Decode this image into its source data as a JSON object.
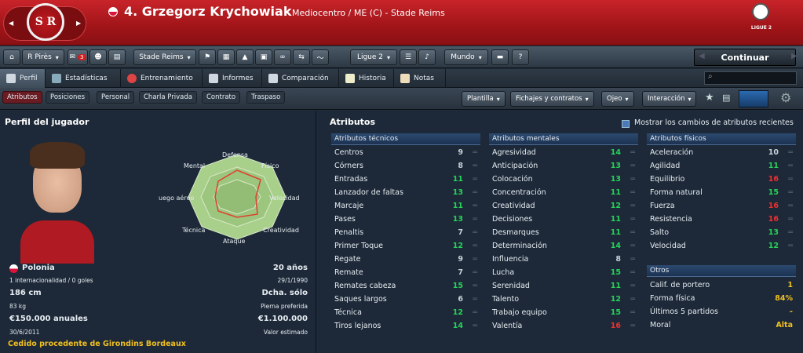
{
  "header": {
    "player_title": "4. Grzegorz Krychowiak",
    "role": "Mediocentro / ME (C) - Stade Reims",
    "crest_text": "S R",
    "league_text": "LIGUE 2"
  },
  "toolbar": {
    "manager": "R Pirès",
    "notifications": "3",
    "club": "Stade Reims",
    "league": "Ligue 2",
    "world": "Mundo",
    "continue": "Continuar"
  },
  "tabs": [
    "Perfil",
    "Estadísticas",
    "Entrenamiento",
    "Informes",
    "Comparación",
    "Historia",
    "Notas"
  ],
  "subtabs": [
    "Atributos",
    "Posiciones",
    "Personal",
    "Charla Privada",
    "Contrato",
    "Traspaso"
  ],
  "sub_menus": [
    "Plantilla",
    "Fichajes y contratos",
    "Ojeo",
    "Interacción"
  ],
  "profile": {
    "title": "Perfil del jugador",
    "radar": [
      "Defensa",
      "Físico",
      "Velocidad",
      "Creatividad",
      "Ataque",
      "Técnica",
      "uego aéreo",
      "Mental"
    ],
    "nation": "Polonia",
    "caps": "1 internacionalidad / 0 goles",
    "height": "186 cm",
    "weight": "83 kg",
    "wage": "€150.000 anuales",
    "contract_end": "30/6/2011",
    "age": "20 años",
    "dob": "29/1/1990",
    "foot": "Dcha. sólo",
    "foot_label": "Pierna preferida",
    "value": "€1.100.000",
    "value_label": "Valor estimado",
    "loan": "Cedido procedente de Girondins Bordeaux"
  },
  "attributes": {
    "title": "Atributos",
    "recent_label": "Mostrar los cambios de atributos recientes",
    "tech_head": "Atributos técnicos",
    "mental_head": "Atributos mentales",
    "phys_head": "Atributos físicos",
    "other_head": "Otros",
    "technical": [
      [
        "Centros",
        "9"
      ],
      [
        "Córners",
        "8"
      ],
      [
        "Entradas",
        "11"
      ],
      [
        "Lanzador de faltas",
        "13"
      ],
      [
        "Marcaje",
        "11"
      ],
      [
        "Pases",
        "13"
      ],
      [
        "Penaltis",
        "7"
      ],
      [
        "Primer Toque",
        "12"
      ],
      [
        "Regate",
        "9"
      ],
      [
        "Remate",
        "7"
      ],
      [
        "Remates cabeza",
        "15"
      ],
      [
        "Saques largos",
        "6"
      ],
      [
        "Técnica",
        "12"
      ],
      [
        "Tiros lejanos",
        "14"
      ]
    ],
    "mental": [
      [
        "Agresividad",
        "14"
      ],
      [
        "Anticipación",
        "13"
      ],
      [
        "Colocación",
        "13"
      ],
      [
        "Concentración",
        "11"
      ],
      [
        "Creatividad",
        "12"
      ],
      [
        "Decisiones",
        "11"
      ],
      [
        "Desmarques",
        "11"
      ],
      [
        "Determinación",
        "14"
      ],
      [
        "Influencia",
        "8"
      ],
      [
        "Lucha",
        "15"
      ],
      [
        "Serenidad",
        "11"
      ],
      [
        "Talento",
        "12"
      ],
      [
        "Trabajo equipo",
        "15"
      ],
      [
        "Valentía",
        "16"
      ]
    ],
    "physical": [
      [
        "Aceleración",
        "10"
      ],
      [
        "Agilidad",
        "11"
      ],
      [
        "Equilibrio",
        "16"
      ],
      [
        "Forma natural",
        "15"
      ],
      [
        "Fuerza",
        "16"
      ],
      [
        "Resistencia",
        "16"
      ],
      [
        "Salto",
        "13"
      ],
      [
        "Velocidad",
        "12"
      ]
    ],
    "other": [
      [
        "Calif. de portero",
        "1"
      ],
      [
        "Forma física",
        "84%"
      ],
      [
        "Últimos 5 partidos",
        "-"
      ],
      [
        "Moral",
        "Alta"
      ]
    ]
  },
  "colors": {
    "high": "#27d35a",
    "mid": "#c8d0d8",
    "top": "#f03030",
    "yellow": "#f0c020"
  }
}
